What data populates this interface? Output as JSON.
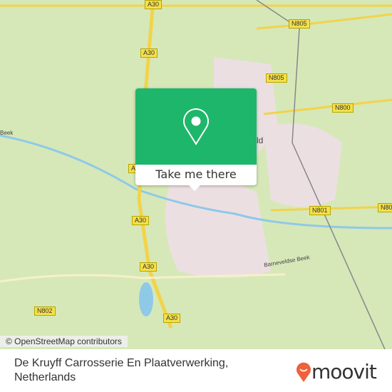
{
  "map": {
    "road_labels": [
      "A30",
      "A30",
      "A30",
      "A30",
      "A30",
      "A30",
      "N805",
      "N805",
      "N800",
      "N801",
      "N801",
      "N802"
    ],
    "place_labels": [
      "Beek",
      "Barneveldse Beek",
      "ld"
    ],
    "attribution": "© OpenStreetMap contributors"
  },
  "popup": {
    "icon": "map-pin-icon",
    "button_label": "Take me there",
    "color": "#1eb66a"
  },
  "footer": {
    "title": "De Kruyff Carrosserie En Plaatverwerking, Netherlands",
    "logo_text": "moovit",
    "logo_color": "#f0603a"
  }
}
